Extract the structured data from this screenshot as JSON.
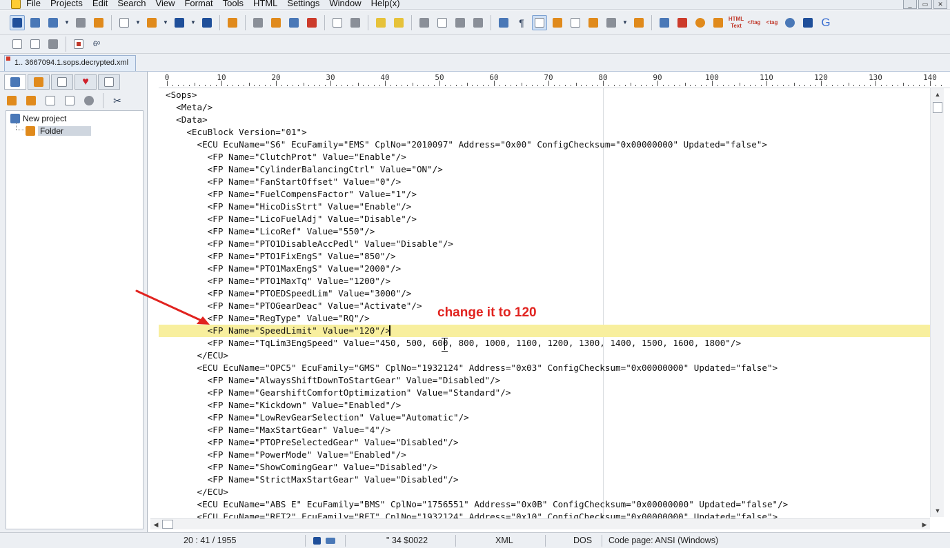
{
  "menubar": {
    "items": [
      "File",
      "Projects",
      "Edit",
      "Search",
      "View",
      "Format",
      "Tools",
      "HTML",
      "Settings",
      "Window",
      "Help(x)"
    ],
    "window_controls": [
      "_",
      "▭",
      "✕"
    ]
  },
  "toolbar1": {
    "groups": [
      [
        "new-project-icon",
        "project-save-icon",
        "project-open-icon",
        "dropdown-arrow-icon",
        "project-settings-icon",
        "project-close-icon"
      ],
      [
        "new-file-icon",
        "dropdown-arrow-icon",
        "open-folder-icon",
        "dropdown-arrow-icon",
        "save-icon",
        "dropdown-arrow-icon",
        "save-all-icon"
      ],
      [
        "run-icon"
      ],
      [
        "find-icon",
        "replace-icon",
        "find-in-files-icon",
        "bookmark-icon"
      ],
      [
        "print-preview-icon",
        "print-icon"
      ],
      [
        "undo-icon",
        "redo-icon"
      ],
      [
        "cut-icon",
        "copy-icon",
        "paste-icon",
        "delete-icon"
      ],
      [
        "word-wrap-icon",
        "paragraph-icon",
        "show-special-chars-icon",
        "case-icon",
        "column-mode-icon",
        "lock-icon",
        "encoding-icon",
        "dropdown-arrow-icon",
        "indent-icon"
      ],
      [
        "html-validate-icon",
        "html-preview-icon",
        "color-picker-icon",
        "font-icon",
        "html-text-icon",
        "tag-close-icon",
        "tag-icon",
        "browser-icon",
        "filter-icon",
        "google-icon"
      ]
    ],
    "labels": {
      "html_text": "HTML\nText",
      "tag_close": "</tag",
      "tag": "<tag",
      "google": "G",
      "paragraph": "¶"
    }
  },
  "toolbar2": {
    "buttons": [
      "run-script-icon",
      "macro-icon",
      "console-icon",
      "stop-icon",
      "spectacles-icon"
    ]
  },
  "document_tab": {
    "label": "1.. 3667094.1.sops.decrypted.xml"
  },
  "left_panel": {
    "tabs": [
      "project-tab-icon",
      "folder-tab-icon",
      "ftp-tab-icon",
      "favorites-tab-icon",
      "window-tab-icon"
    ],
    "toolbar": [
      "add-file-icon",
      "remove-file-icon",
      "add-folder-icon",
      "remove-folder-icon",
      "info-icon",
      "settings-icon"
    ],
    "tree": {
      "project": "New project",
      "folder": "Folder"
    }
  },
  "editor": {
    "ruler_labels": [
      "0",
      "10",
      "20",
      "30",
      "40",
      "50",
      "60",
      "70",
      "80",
      "90",
      "100",
      "110",
      "120",
      "130",
      "140"
    ],
    "highlighted_line_index": 19,
    "lines": [
      "<Sops>",
      "  <Meta/>",
      "  <Data>",
      "    <EcuBlock Version=\"01\">",
      "      <ECU EcuName=\"S6\" EcuFamily=\"EMS\" CplNo=\"2010097\" Address=\"0x00\" ConfigChecksum=\"0x00000000\" Updated=\"false\">",
      "        <FP Name=\"ClutchProt\" Value=\"Enable\"/>",
      "        <FP Name=\"CylinderBalancingCtrl\" Value=\"ON\"/>",
      "        <FP Name=\"FanStartOffset\" Value=\"0\"/>",
      "        <FP Name=\"FuelCompensFactor\" Value=\"1\"/>",
      "        <FP Name=\"HicoDisStrt\" Value=\"Enable\"/>",
      "        <FP Name=\"LicoFuelAdj\" Value=\"Disable\"/>",
      "        <FP Name=\"LicoRef\" Value=\"550\"/>",
      "        <FP Name=\"PTO1DisableAccPedl\" Value=\"Disable\"/>",
      "        <FP Name=\"PTO1FixEngS\" Value=\"850\"/>",
      "        <FP Name=\"PTO1MaxEngS\" Value=\"2000\"/>",
      "        <FP Name=\"PTO1MaxTq\" Value=\"1200\"/>",
      "        <FP Name=\"PTOEDSpeedLim\" Value=\"3000\"/>",
      "        <FP Name=\"PTOGearDeac\" Value=\"Activate\"/>",
      "        <FP Name=\"RegType\" Value=\"RQ\"/>",
      "        <FP Name=\"SpeedLimit\" Value=\"120\"/>",
      "        <FP Name=\"TqLim3EngSpeed\" Value=\"450, 500, 600, 800, 1000, 1100, 1200, 1300, 1400, 1500, 1600, 1800\"/>",
      "      </ECU>",
      "      <ECU EcuName=\"OPC5\" EcuFamily=\"GMS\" CplNo=\"1932124\" Address=\"0x03\" ConfigChecksum=\"0x00000000\" Updated=\"false\">",
      "        <FP Name=\"AlwaysShiftDownToStartGear\" Value=\"Disabled\"/>",
      "        <FP Name=\"GearshiftComfortOptimization\" Value=\"Standard\"/>",
      "        <FP Name=\"Kickdown\" Value=\"Enabled\"/>",
      "        <FP Name=\"LowRevGearSelection\" Value=\"Automatic\"/>",
      "        <FP Name=\"MaxStartGear\" Value=\"4\"/>",
      "        <FP Name=\"PTOPreSelectedGear\" Value=\"Disabled\"/>",
      "        <FP Name=\"PowerMode\" Value=\"Enabled\"/>",
      "        <FP Name=\"ShowComingGear\" Value=\"Disabled\"/>",
      "        <FP Name=\"StrictMaxStartGear\" Value=\"Disabled\"/>",
      "      </ECU>",
      "      <ECU EcuName=\"ABS E\" EcuFamily=\"BMS\" CplNo=\"1756551\" Address=\"0x0B\" ConfigChecksum=\"0x00000000\" Updated=\"false\"/>",
      "      <ECU EcuName=\"RET2\" EcuFamily=\"RET\" CplNo=\"1932124\" Address=\"0x10\" ConfigChecksum=\"0x00000000\" Updated=\"false\">"
    ]
  },
  "annotation": {
    "text": "change it to 120"
  },
  "statusbar": {
    "position": "20 : 41 / 1955",
    "char_info": "\"  34  $0022",
    "file_type": "XML",
    "line_ending": "DOS",
    "code_page": "Code page: ANSI (Windows)"
  },
  "colors": {
    "highlight_line": "#f8ef9e",
    "code_text": "#1c2f7c",
    "annotation": "#e1231f",
    "chrome": "#eceff3"
  }
}
